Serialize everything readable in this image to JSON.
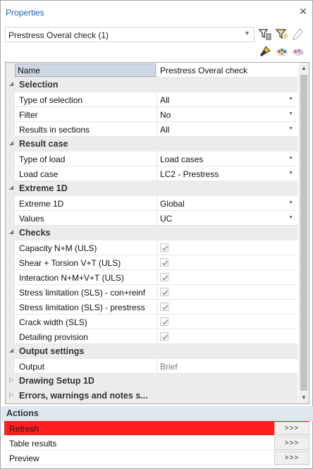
{
  "panel": {
    "title": "Properties"
  },
  "selector": {
    "value": "Prestress Overal check (1)"
  },
  "name_row": {
    "label": "Name",
    "value": "Prestress Overal check"
  },
  "sections": [
    {
      "title": "Selection",
      "rows": [
        {
          "label": "Type of selection",
          "value": "All"
        },
        {
          "label": "Filter",
          "value": "No"
        },
        {
          "label": "Results in sections",
          "value": "All"
        }
      ]
    },
    {
      "title": "Result case",
      "rows": [
        {
          "label": "Type of load",
          "value": "Load cases"
        },
        {
          "label": "Load case",
          "value": "LC2 - Prestress"
        }
      ]
    },
    {
      "title": "Extreme 1D",
      "rows": [
        {
          "label": "Extreme 1D",
          "value": "Global"
        },
        {
          "label": "Values",
          "value": "UC"
        }
      ]
    },
    {
      "title": "Checks",
      "rows": [
        {
          "label": "Capacity N+M (ULS)",
          "checked": true
        },
        {
          "label": "Shear + Torsion V+T (ULS)",
          "checked": true
        },
        {
          "label": "Interaction N+M+V+T (ULS)",
          "checked": true
        },
        {
          "label": "Stress limitation (SLS) - con+reinf",
          "checked": true
        },
        {
          "label": "Stress limitation (SLS) - prestress",
          "checked": true
        },
        {
          "label": "Crack width (SLS)",
          "checked": true
        },
        {
          "label": "Detailing provision",
          "checked": true
        }
      ]
    },
    {
      "title": "Output settings",
      "rows": [
        {
          "label": "Output",
          "value": "Brief"
        }
      ]
    },
    {
      "title": "Drawing Setup 1D"
    },
    {
      "title": "Errors, warnings and notes s..."
    }
  ],
  "actions": {
    "title": "Actions",
    "items": [
      {
        "label": "Refresh",
        "button": ">>>"
      },
      {
        "label": "Table results",
        "button": ">>>"
      },
      {
        "label": "Preview",
        "button": ">>>"
      }
    ]
  },
  "icons": [
    "close-icon",
    "filter-select-icon",
    "filter-icon",
    "pencil-icon",
    "brush-icon",
    "color-palette-icon",
    "clear-colors-icon",
    "expand-icon",
    "collapse-icon",
    "checkbox-icon"
  ],
  "colors": {
    "title": "#1c5fa9",
    "category_bg": "#ececec",
    "highlight": "#ff1f1f",
    "actions_header": "#dfe7ef"
  }
}
